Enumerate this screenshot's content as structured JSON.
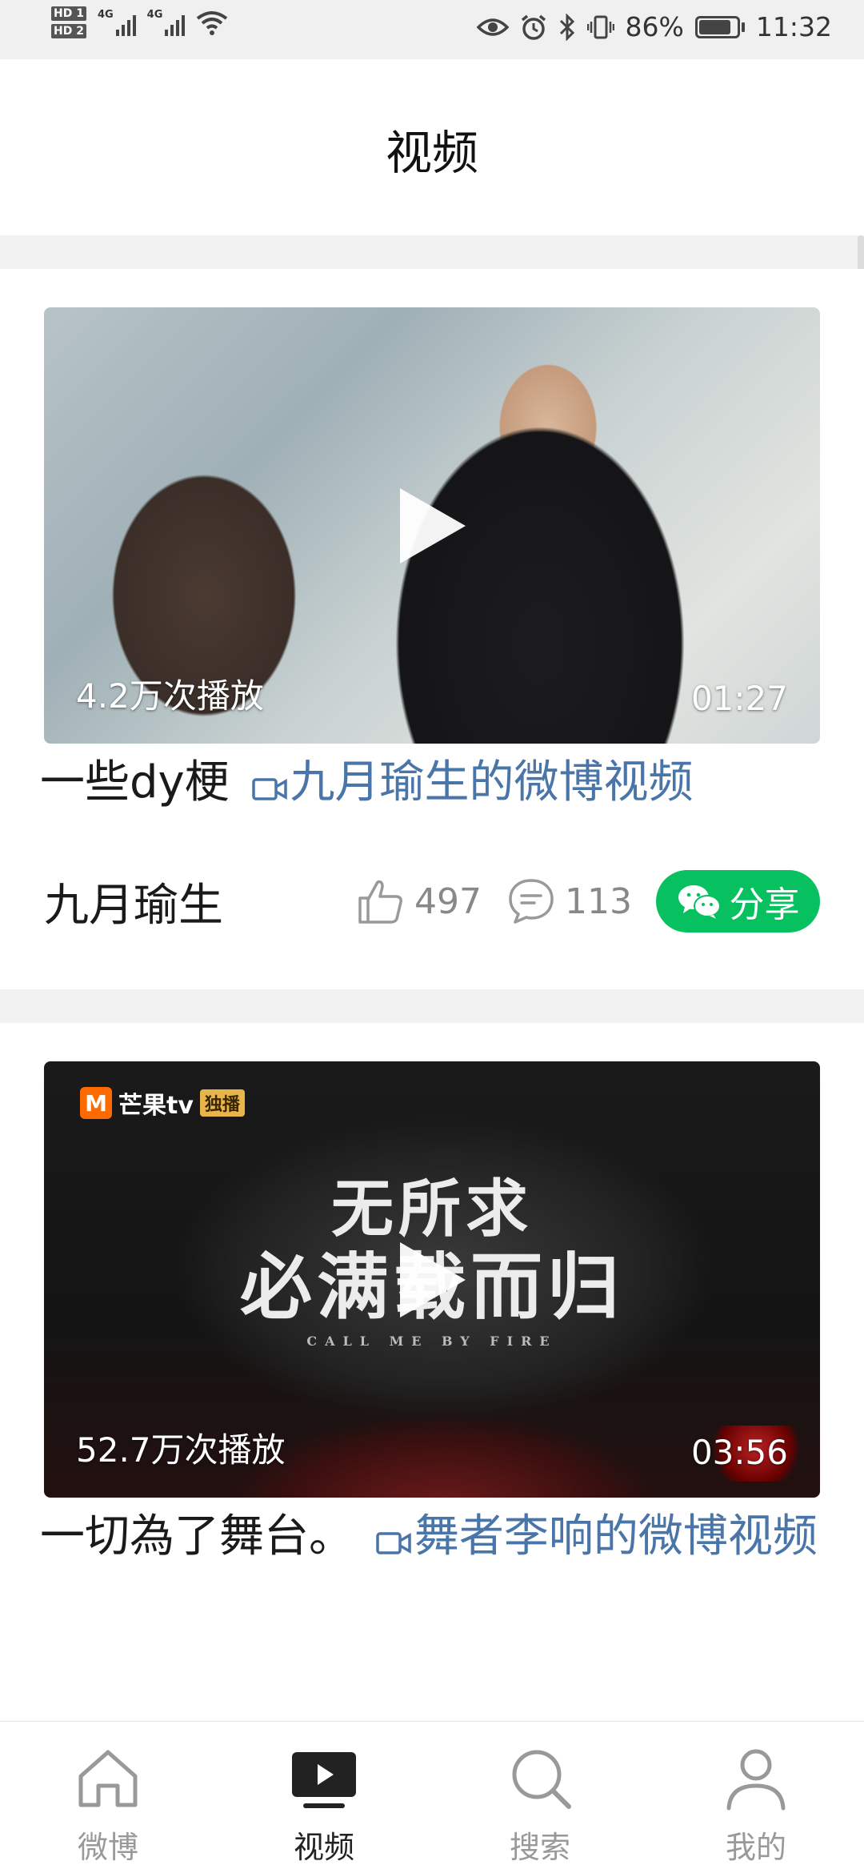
{
  "status_bar": {
    "hd1": "HD 1",
    "hd2": "HD 2",
    "net1": "4G",
    "net2": "4G",
    "battery_pct": "86%",
    "battery_level": 0.86,
    "time": "11:32",
    "icons": [
      "signal-icon",
      "wifi-icon",
      "eye-icon",
      "alarm-icon",
      "bluetooth-icon",
      "vibrate-icon",
      "battery-icon"
    ]
  },
  "header": {
    "title": "视频"
  },
  "feed": [
    {
      "views": "4.2万次播放",
      "duration": "01:27",
      "caption_text": "一些dy梗",
      "caption_link": "九月瑜生的微博视频",
      "author": "九月瑜生",
      "likes": "497",
      "comments": "113",
      "share_label": "分享"
    },
    {
      "views": "52.7万次播放",
      "duration": "03:56",
      "brand": "芒果tv",
      "brand_badge": "独播",
      "show_title_line1": "无所求",
      "show_title_line2": "必满载而归",
      "show_subtitle": "CALL ME BY FIRE",
      "caption_text": "一切為了舞台。",
      "caption_link": "舞者李响的微博视频"
    }
  ],
  "tabbar": {
    "items": [
      {
        "label": "微博",
        "icon": "home-icon",
        "active": false
      },
      {
        "label": "视频",
        "icon": "video-icon",
        "active": true
      },
      {
        "label": "搜索",
        "icon": "search-icon",
        "active": false
      },
      {
        "label": "我的",
        "icon": "profile-icon",
        "active": false
      }
    ]
  },
  "colors": {
    "accent_green": "#07c160",
    "link_blue": "#4a75a8",
    "inactive_gray": "#999999"
  }
}
